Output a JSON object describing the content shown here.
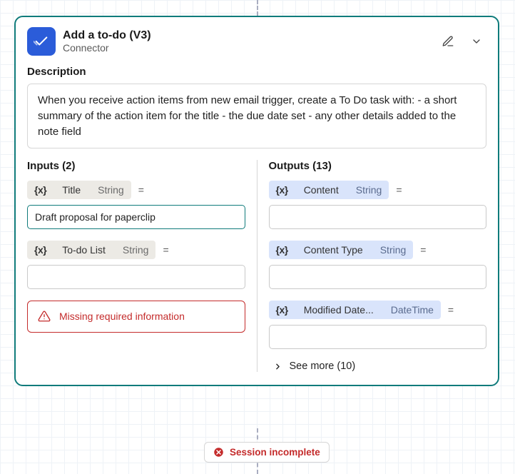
{
  "header": {
    "title": "Add a to-do (V3)",
    "subtitle": "Connector"
  },
  "description": {
    "label": "Description",
    "text": "When you receive action items from new email trigger, create a To Do task with: - a short summary of the action item for the title - the due date set - any other details added to the note field"
  },
  "inputs": {
    "title": "Inputs (2)",
    "fields": [
      {
        "token": "{x}",
        "name": "Title",
        "type": "String",
        "eq": "=",
        "value": "Draft proposal for paperclip",
        "active": true
      },
      {
        "token": "{x}",
        "name": "To-do List",
        "type": "String",
        "eq": "=",
        "value": "",
        "active": false
      }
    ],
    "error": "Missing required information"
  },
  "outputs": {
    "title": "Outputs (13)",
    "fields": [
      {
        "token": "{x}",
        "name": "Content",
        "type": "String",
        "eq": "=",
        "value": ""
      },
      {
        "token": "{x}",
        "name": "Content Type",
        "type": "String",
        "eq": "=",
        "value": ""
      },
      {
        "token": "{x}",
        "name": "Modified Date...",
        "type": "DateTime",
        "eq": "=",
        "value": ""
      }
    ],
    "see_more": "See more (10)"
  },
  "status": "Session incomplete"
}
